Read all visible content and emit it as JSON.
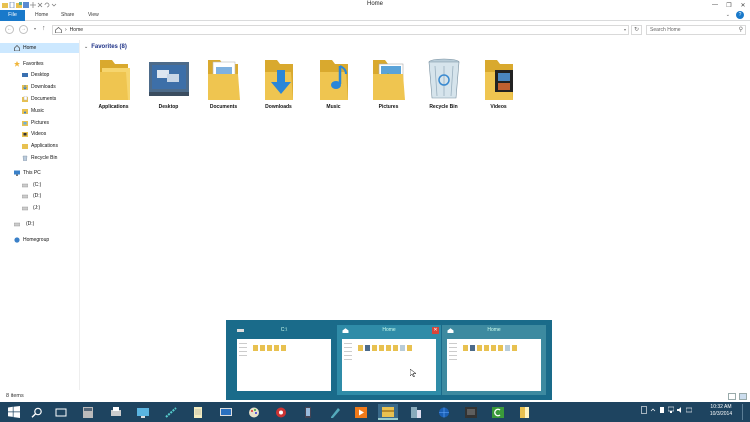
{
  "window": {
    "title": "Home",
    "controls": {
      "minimize": "—",
      "maximize": "❐",
      "close": "✕"
    }
  },
  "ribbon": {
    "file": "File",
    "tabs": [
      "Home",
      "Share",
      "View"
    ],
    "expand": "⌄",
    "help": "?"
  },
  "address": {
    "back": "←",
    "forward": "→",
    "up": "↑",
    "separator": "›",
    "path": "Home",
    "refresh": "↻",
    "search_placeholder": "Search Home",
    "search_glyph": "⚲"
  },
  "nav": {
    "items": [
      {
        "label": "Home",
        "icon": "home-icon",
        "selected": true
      },
      {
        "label": "Favorites",
        "icon": "star-icon"
      },
      {
        "label": "Desktop",
        "icon": "desktop-icon"
      },
      {
        "label": "Downloads",
        "icon": "downloads-icon"
      },
      {
        "label": "Documents",
        "icon": "documents-icon"
      },
      {
        "label": "Music",
        "icon": "music-icon"
      },
      {
        "label": "Pictures",
        "icon": "pictures-icon"
      },
      {
        "label": "Videos",
        "icon": "videos-icon"
      },
      {
        "label": "Applications",
        "icon": "applications-icon"
      },
      {
        "label": "Recycle Bin",
        "icon": "recycle-bin-icon"
      },
      {
        "label": "This PC",
        "icon": "computer-icon"
      },
      {
        "label": "(C:)",
        "icon": "drive-icon"
      },
      {
        "label": "(D:)",
        "icon": "drive-icon"
      },
      {
        "label": "(J:)",
        "icon": "drive-icon"
      },
      {
        "label": "(D:)",
        "icon": "drive-icon"
      },
      {
        "label": "Homegroup",
        "icon": "homegroup-icon"
      }
    ]
  },
  "content": {
    "group": "Favorites (8)",
    "group_chevron": "⌄",
    "tiles": [
      {
        "label": "Applications",
        "icon": "applications-folder-icon"
      },
      {
        "label": "Desktop",
        "icon": "desktop-icon"
      },
      {
        "label": "Documents",
        "icon": "documents-folder-icon"
      },
      {
        "label": "Downloads",
        "icon": "downloads-folder-icon"
      },
      {
        "label": "Music",
        "icon": "music-folder-icon"
      },
      {
        "label": "Pictures",
        "icon": "pictures-folder-icon"
      },
      {
        "label": "Recycle Bin",
        "icon": "recycle-bin-icon"
      },
      {
        "label": "Videos",
        "icon": "videos-folder-icon"
      }
    ]
  },
  "status": {
    "count": "8 items"
  },
  "thumbnails": [
    {
      "title": "C:\\",
      "close": ""
    },
    {
      "title": "Home",
      "close": "✕"
    },
    {
      "title": "Home",
      "close": ""
    }
  ],
  "taskbar": {
    "time": "10:32 AM",
    "date": "10/3/2014"
  },
  "colors": {
    "accent": "#1979ca",
    "taskbar": "#1e4460",
    "folder": "#e8c150",
    "selection": "#cce8ff",
    "group_heading": "#1e3287"
  }
}
